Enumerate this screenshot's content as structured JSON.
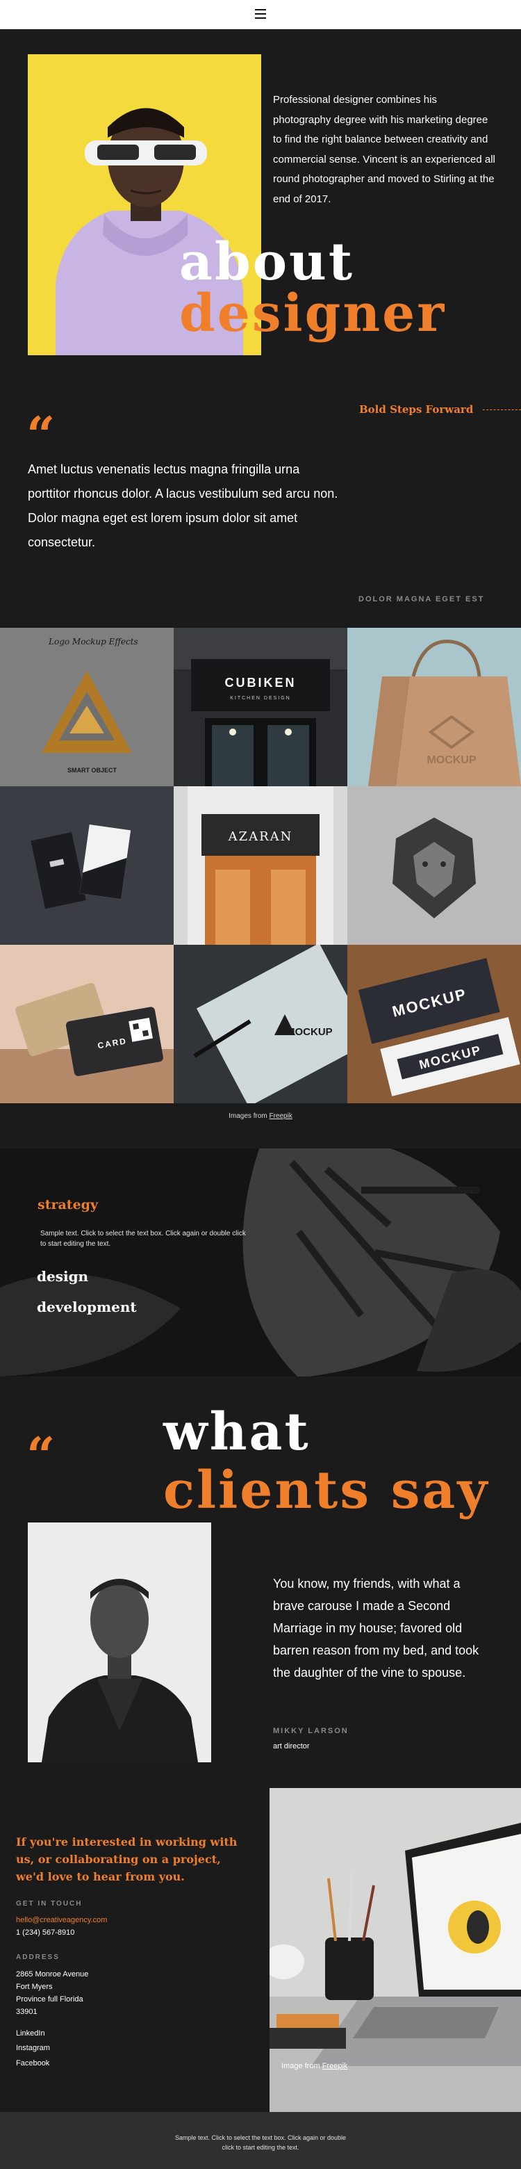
{
  "nav": {
    "menu_icon": "hamburger-icon"
  },
  "hero": {
    "intro": "Professional designer combines his photography degree with his marketing degree to find the right balance between creativity and commercial sense. Vincent is an experienced all round photographer and moved to Stirling at the end of 2017.",
    "title_line1": "about",
    "title_line2": "designer"
  },
  "quote_section": {
    "tagline": "Bold Steps Forward",
    "text": "Amet luctus venenatis lectus magna fringilla urna porttitor rhoncus dolor. A lacus vestibulum sed arcu non. Dolor magna eget est lorem ipsum dolor sit amet consectetur.",
    "label": "DOLOR MAGNA EGET EST"
  },
  "gallery": {
    "tiles": [
      {
        "caption": "Logo Mockup Effects",
        "sub": "SMART OBJECT"
      },
      {
        "caption": "CUBIKEN",
        "sub": "KITCHEN DESIGN"
      },
      {
        "caption": "MOCKUP",
        "sub": ""
      },
      {
        "caption": "",
        "sub": ""
      },
      {
        "caption": "AZARAN",
        "sub": ""
      },
      {
        "caption": "",
        "sub": ""
      },
      {
        "caption": "CARD",
        "sub": ""
      },
      {
        "caption": "MOCKUP",
        "sub": ""
      },
      {
        "caption": "MOCKUP",
        "sub": "MOCKUP"
      }
    ],
    "credit_prefix": "Images from",
    "credit_link": "Freepik"
  },
  "strategy": {
    "title": "strategy",
    "sample": "Sample text. Click to select the text box. Click again or double click to start editing the text.",
    "items": [
      "design",
      "development"
    ]
  },
  "testimonial": {
    "title_line1": "what",
    "title_line2": "clients say",
    "text": "You know, my friends, with what a brave carouse I made a Second Marriage in my house; favored old barren reason from my bed, and took the daughter of the vine to spouse.",
    "name": "MIKKY LARSON",
    "role": "art director"
  },
  "contact": {
    "heading": "If you're interested in working with us, or collaborating on a project, we'd love to hear from you.",
    "get_in_touch_label": "GET IN TOUCH",
    "email": "hello@creativeagency.com",
    "phone": "1 (234) 567-8910",
    "address_label": "ADDRESS",
    "address_lines": [
      "2865 Monroe Avenue",
      "Fort Myers",
      "Province full Florida",
      "33901"
    ],
    "social": [
      "LinkedIn",
      "Instagram",
      "Facebook"
    ],
    "photo_credit_prefix": "Image from",
    "photo_credit_link": "Freepik"
  },
  "footer": {
    "text": "Sample text. Click to select the text box. Click again or double click to start editing the text."
  },
  "colors": {
    "accent": "#f07f2c",
    "background": "#1b1b1c",
    "hero_bg": "#f4da3c"
  }
}
